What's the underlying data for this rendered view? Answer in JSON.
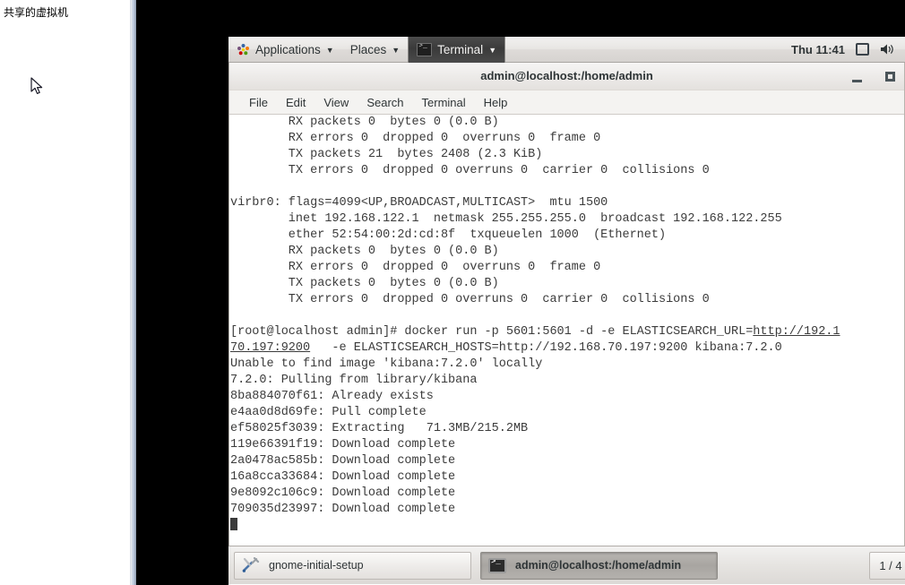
{
  "host": {
    "label": "共享的虚拟机",
    "cursor_icon": "arrow-pointer-icon"
  },
  "gnome_panel": {
    "applications_label": "Applications",
    "places_label": "Places",
    "terminal_label": "Terminal",
    "caret": "▼",
    "clock": "Thu 11:41",
    "icons": [
      "display-icon",
      "volume-icon"
    ]
  },
  "terminal_window": {
    "title": "admin@localhost:/home/admin",
    "minimize_label": "",
    "maximize_label": "",
    "menu": [
      "File",
      "Edit",
      "View",
      "Search",
      "Terminal",
      "Help"
    ]
  },
  "terminal_output": {
    "lines": [
      "        RX packets 0  bytes 0 (0.0 B)",
      "        RX errors 0  dropped 0  overruns 0  frame 0",
      "        TX packets 21  bytes 2408 (2.3 KiB)",
      "        TX errors 0  dropped 0 overruns 0  carrier 0  collisions 0",
      "",
      "virbr0: flags=4099<UP,BROADCAST,MULTICAST>  mtu 1500",
      "        inet 192.168.122.1  netmask 255.255.255.0  broadcast 192.168.122.255",
      "        ether 52:54:00:2d:cd:8f  txqueuelen 1000  (Ethernet)",
      "        RX packets 0  bytes 0 (0.0 B)",
      "        RX errors 0  dropped 0  overruns 0  frame 0",
      "        TX packets 0  bytes 0 (0.0 B)",
      "        TX errors 0  dropped 0 overruns 0  carrier 0  collisions 0",
      "",
      "[root@localhost admin]# docker run -p 5601:5601 -d -e ELASTICSEARCH_URL=http://192.1",
      "70.197:9200   -e ELASTICSEARCH_HOSTS=http://192.168.70.197:9200 kibana:7.2.0",
      "Unable to find image 'kibana:7.2.0' locally",
      "7.2.0: Pulling from library/kibana",
      "8ba884070f61: Already exists",
      "e4aa0d8d69fe: Pull complete",
      "ef58025f3039: Extracting   71.3MB/215.2MB",
      "119e66391f19: Download complete",
      "2a0478ac585b: Download complete",
      "16a8cca33684: Download complete",
      "9e8092c106c9: Download complete",
      "709035d23997: Download complete"
    ],
    "underlined_segments": {
      "line_13_url": "http://192.1",
      "line_14_url": "70.197:9200"
    },
    "cursor": "block-cursor"
  },
  "taskbar": {
    "items": [
      {
        "label": "gnome-initial-setup",
        "icon": "tools-icon",
        "active": false
      },
      {
        "label": "admin@localhost:/home/admin",
        "icon": "terminal-icon",
        "active": true
      }
    ],
    "workspace_indicator": "1 / 4"
  },
  "colors": {
    "desktop_background": "#000000",
    "panel_background": "#e8e6e3",
    "terminal_background": "#ffffff",
    "terminal_text": "#3b3b3b",
    "host_panel_background": "#ffffff"
  }
}
